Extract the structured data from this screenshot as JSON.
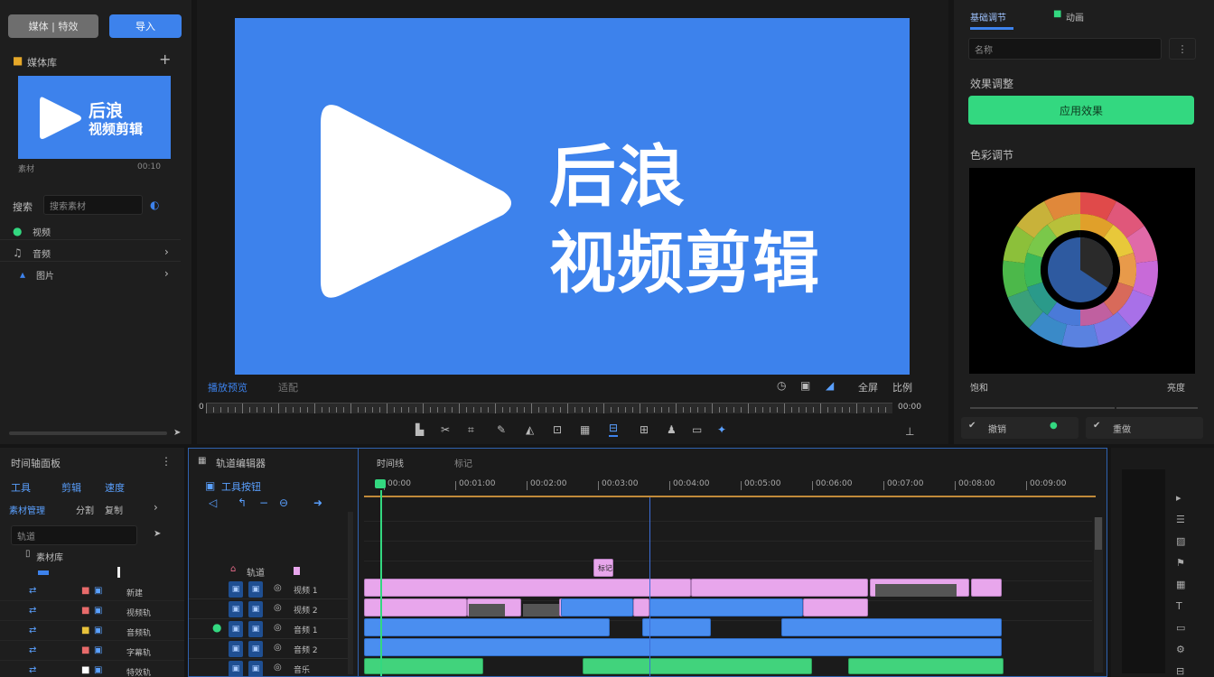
{
  "left_panel": {
    "toolbar_left_label": "媒体 | 特效",
    "toolbar_right_label": "导入",
    "section_title": "媒体库",
    "add_symbol": "+",
    "thumb_line1": "后浪",
    "thumb_line2": "视频剪辑",
    "thumb_meta_left": "素材",
    "thumb_meta_right": "00:10",
    "search_label": "搜索",
    "search_placeholder": "搜索素材",
    "list": [
      {
        "label": "视频"
      },
      {
        "label": "音频"
      },
      {
        "label": "图片"
      }
    ]
  },
  "preview": {
    "title_line1": "后浪",
    "title_line2": "视频剪辑",
    "bottom_left_label": "播放预览",
    "bottom_left_sub": "适配",
    "bottom_right_label": "全屏",
    "bottom_right_label2": "比例",
    "timecode_start": "0",
    "timecode_end": "00:00"
  },
  "right_panel": {
    "header_label": "基础调节",
    "header_tab2": "动画",
    "input_placeholder": "名称",
    "section_label": "效果调整",
    "apply_button": "应用效果",
    "color_label": "色彩调节",
    "footer_left": "饱和",
    "footer_right": "亮度",
    "bottom_btn1": "撤销",
    "bottom_btn2": "重做"
  },
  "bottom_left": {
    "title": "时间轴面板",
    "tabs": [
      "工具",
      "剪辑",
      "速度"
    ],
    "row2": [
      "素材管理",
      "分割",
      "复制"
    ],
    "search_label": "轨道",
    "sub_label": "素材库",
    "rows": [
      {
        "tag": "新建"
      },
      {
        "tag": "视频轨"
      },
      {
        "tag": "音频轨"
      },
      {
        "tag": "字幕轨"
      },
      {
        "tag": "特效轨"
      }
    ]
  },
  "timeline": {
    "header_title": "轨道编辑器",
    "header_sub": "工具按钮",
    "tab1": "时间线",
    "tab2": "标记",
    "ruler": [
      "00:00",
      "00:01:00",
      "00:02:00",
      "00:03:00",
      "00:04:00",
      "00:05:00",
      "00:06:00",
      "00:07:00",
      "00:08:00",
      "00:09:00"
    ],
    "track_label_main": "轨道",
    "track_labels": [
      "视频 1",
      "视频 2",
      "音频 1",
      "音频 2",
      "音乐"
    ],
    "marker": "标记"
  },
  "colors": {
    "accent_blue": "#3d82ec",
    "accent_green": "#33d880",
    "pink_clip": "#e8a6ec",
    "panel_bg": "#1e1e1e"
  }
}
